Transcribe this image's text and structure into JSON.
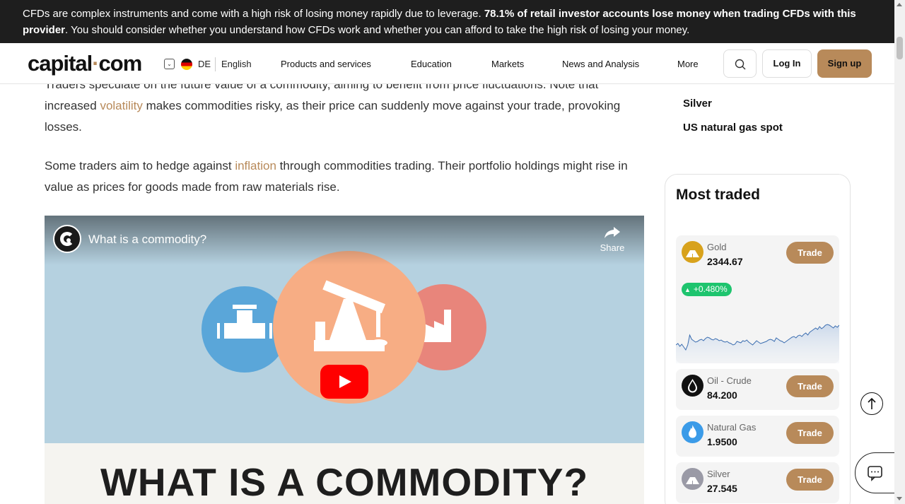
{
  "risk_banner": {
    "text_start": "CFDs are complex instruments and come with a high risk of losing money rapidly due to leverage. ",
    "text_bold": "78.1% of retail investor accounts lose money when trading CFDs with this provider",
    "text_end": ". You should consider whether you understand how CFDs work and whether you can afford to take the high risk of losing your money."
  },
  "header": {
    "logo_left": "capital",
    "logo_dot": "·",
    "logo_right": "com",
    "locale_code": "DE",
    "language": "English",
    "nav": [
      "Products and services",
      "Education",
      "Markets",
      "News and Analysis",
      "More"
    ],
    "login": "Log In",
    "signup": "Sign up"
  },
  "article": {
    "p1_start": "Traders speculate on the future value of a commodity, aiming to benefit from price fluctuations. Note that increased ",
    "p1_link": "volatility",
    "p1_end": " makes commodities risky, as their price can suddenly move against your trade, provoking losses.",
    "p2_start": "Some traders aim to hedge against ",
    "p2_link": "inflation",
    "p2_end": " through commodities trading. Their portfolio holdings might rise in value as prices for goods made from raw materials rise.",
    "video": {
      "title": "What is a commodity?",
      "share": "Share",
      "heading": "WHAT IS A COMMODITY?"
    }
  },
  "sidebar": {
    "links": [
      "Silver",
      "US natural gas spot"
    ],
    "most_traded_title": "Most traded",
    "assets": [
      {
        "name": "Gold",
        "price": "2344.67",
        "trade": "Trade",
        "change": "+0.480%",
        "icon": "gold-icon",
        "color": "#d8a21c"
      },
      {
        "name": "Oil - Crude",
        "price": "84.200",
        "trade": "Trade",
        "icon": "oil-drop-icon",
        "color": "#111111"
      },
      {
        "name": "Natural Gas",
        "price": "1.9500",
        "trade": "Trade",
        "icon": "flame-icon",
        "color": "#3b9be8"
      },
      {
        "name": "Silver",
        "price": "27.545",
        "trade": "Trade",
        "icon": "silver-icon",
        "color": "#9a9aa6"
      }
    ],
    "gold_sparkline": [
      38,
      36,
      40,
      37,
      41,
      45,
      38,
      24,
      30,
      32,
      34,
      33,
      31,
      30,
      32,
      29,
      27,
      28,
      30,
      31,
      29,
      30,
      32,
      31,
      33,
      34,
      33,
      35,
      36,
      38,
      37,
      33,
      34,
      35,
      32,
      33,
      31,
      34,
      36,
      38,
      35,
      32,
      34,
      36,
      35,
      34,
      33,
      31,
      30,
      31,
      33,
      28,
      30,
      32,
      33,
      35,
      33,
      31,
      29,
      27,
      26,
      28,
      25,
      24,
      26,
      23,
      21,
      24,
      20,
      18,
      16,
      14,
      16,
      12,
      15,
      13,
      10,
      9,
      10,
      12,
      14,
      11,
      13,
      10
    ]
  },
  "colors": {
    "accent": "#b88a5a",
    "banner_bg": "#1e1e1e",
    "positive": "#1ec46e"
  }
}
